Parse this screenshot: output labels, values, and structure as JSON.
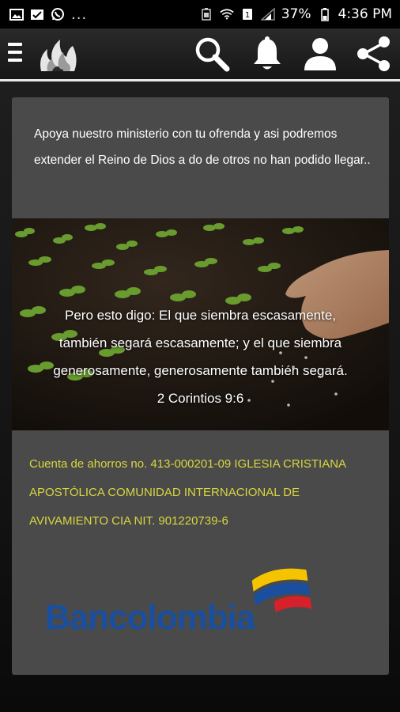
{
  "status_bar": {
    "overflow": "...",
    "battery": "37%",
    "time": "4:36 PM"
  },
  "app_bar": {
    "menu_icon": "hamburger-icon",
    "logo_icon": "flame-logo-icon",
    "actions": [
      "search-icon",
      "bell-icon",
      "user-icon",
      "share-icon"
    ]
  },
  "content": {
    "intro": "Apoya nuestro ministerio con tu ofrenda y asi podremos extender el Reino de Dios a do de otros no han podido llegar..",
    "verse_lines": [
      "Pero esto digo: El que siembra escasamente,",
      "también segará escasamente; y el que siembra",
      "generosamente, generosamente también segará.",
      "2 Corintios 9:6"
    ],
    "bank_text": "Cuenta de ahorros no. 413-000201-09 IGLESIA CRISTIANA APOSTÓLICA COMUNIDAD INTERNACIONAL DE AVIVAMIENTO CIA NIT. 901220739-6",
    "bank_name": "Bancolombia"
  },
  "colors": {
    "card": "#4a4a4a",
    "bank_text": "#d8d640",
    "bank_blue": "#1a4fa0",
    "flag_yellow": "#f5c400",
    "flag_blue": "#1a4fa0",
    "flag_red": "#d6202a"
  }
}
